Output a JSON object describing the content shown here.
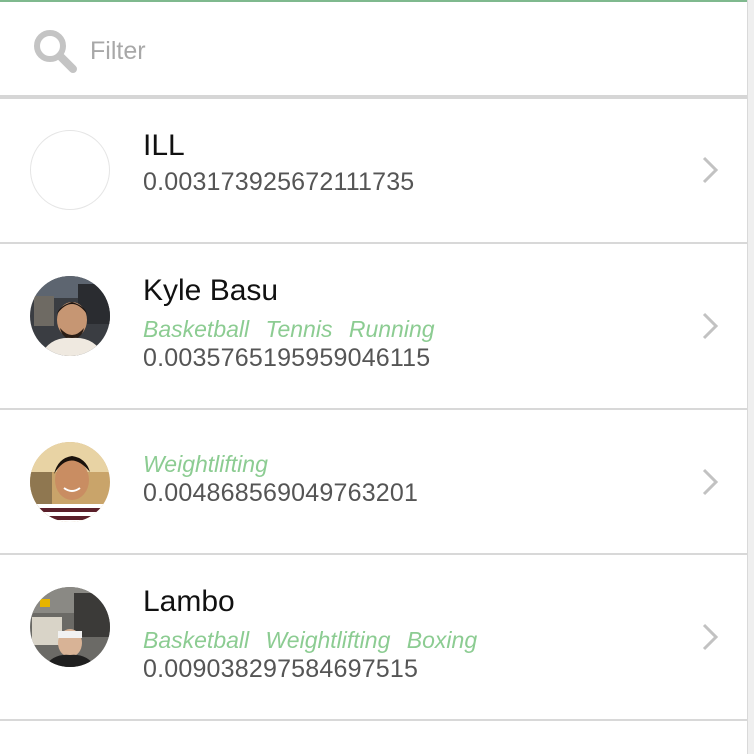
{
  "filter": {
    "placeholder": "Filter",
    "value": "",
    "icon": "search-icon"
  },
  "colors": {
    "accent_green": "#8ccc92",
    "top_line": "#7fb98e",
    "divider": "#d8d8d8",
    "placeholder": "#a8a8a8"
  },
  "rows": [
    {
      "name": "ILL",
      "tags": [],
      "score": "0.003173925672111735",
      "avatar": "blank-avatar"
    },
    {
      "name": "Kyle Basu",
      "tags": [
        "Basketball",
        "Tennis",
        "Running"
      ],
      "score": "0.0035765195959046115",
      "avatar": "photo-avatar"
    },
    {
      "name": "",
      "tags": [
        "Weightlifting"
      ],
      "score": "0.004868569049763201",
      "avatar": "photo-avatar"
    },
    {
      "name": "Lambo",
      "tags": [
        "Basketball",
        "Weightlifting",
        "Boxing"
      ],
      "score": "0.009038297584697515",
      "avatar": "photo-avatar"
    }
  ]
}
